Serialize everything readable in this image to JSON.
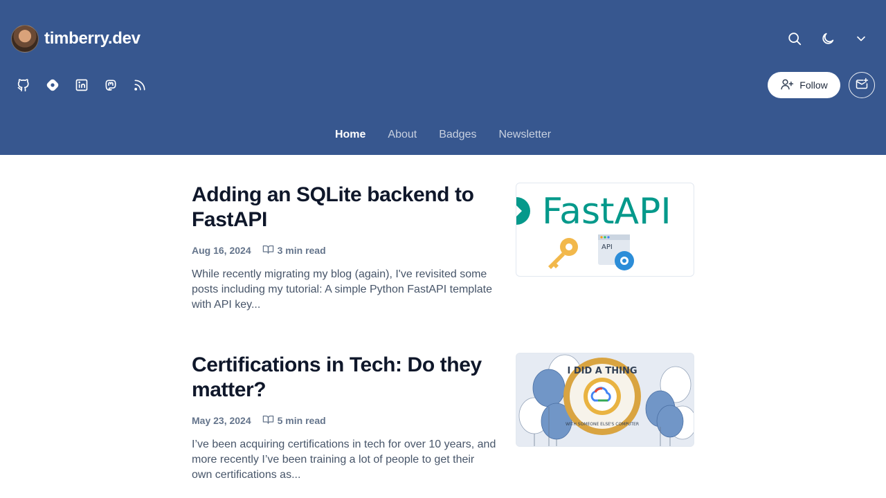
{
  "site": {
    "name": "timberry.dev"
  },
  "header": {
    "icons": {
      "search": "search-icon",
      "theme": "moon-icon",
      "menu": "chevron-down-icon"
    },
    "social": [
      "github-icon",
      "hashnode-icon",
      "linkedin-icon",
      "mastodon-icon",
      "rss-icon"
    ],
    "follow_label": "Follow"
  },
  "nav": {
    "items": [
      {
        "label": "Home",
        "active": true
      },
      {
        "label": "About",
        "active": false
      },
      {
        "label": "Badges",
        "active": false
      },
      {
        "label": "Newsletter",
        "active": false
      }
    ]
  },
  "posts": [
    {
      "title": "Adding an SQLite backend to FastAPI",
      "date": "Aug 16, 2024",
      "read_time": "3 min read",
      "excerpt": "While recently migrating my blog (again), I've revisited some posts including my tutorial: A simple Python FastAPI template with API key...",
      "thumb": {
        "logo_text": "FastAPI",
        "api_label": "API"
      }
    },
    {
      "title": "Certifications in Tech: Do they matter?",
      "date": "May 23, 2024",
      "read_time": "5 min read",
      "excerpt": "I’ve been acquiring certifications in tech for over 10 years, and more recently I’ve been training a lot of people to get their own certifications as...",
      "thumb": {
        "badge_top": "I DID A THING",
        "badge_bottom": "WITH SOMEONE ELSE'S COMPUTER"
      }
    }
  ],
  "colors": {
    "header_bg": "#37578f",
    "fastapi_teal": "#05998b",
    "balloon_blue": "#7196c7",
    "badge_gold": "#d9a441"
  }
}
